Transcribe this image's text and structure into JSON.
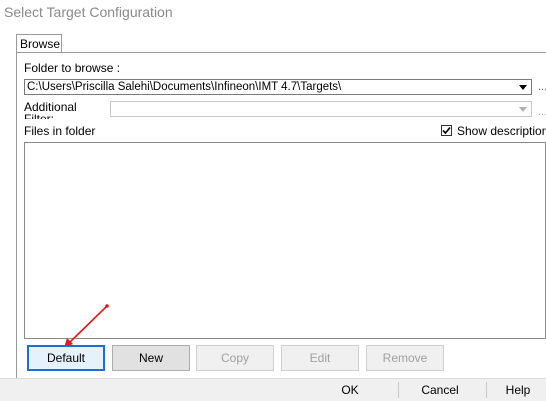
{
  "window": {
    "title": "Select Target Configuration"
  },
  "tabs": [
    {
      "label": "Browse"
    }
  ],
  "folder": {
    "label": "Folder to browse :",
    "value": "C:\\Users\\Priscilla Salehi\\Documents\\Infineon\\IMT 4.7\\Targets\\",
    "ellipsis": "..."
  },
  "filter": {
    "label_line1": "Additional",
    "label_line2": "Filter:",
    "value": "",
    "ellipsis": "..."
  },
  "files": {
    "label": "Files in folder",
    "show_descriptions_label": "Show descriptions",
    "show_descriptions_checked": true,
    "items": []
  },
  "buttons": {
    "default": "Default",
    "new": "New",
    "copy": "Copy",
    "edit": "Edit",
    "remove": "Remove"
  },
  "dialog_buttons": {
    "ok": "OK",
    "cancel": "Cancel",
    "help": "Help"
  },
  "annotation": {
    "arrow_color": "#e01b1b"
  },
  "colors": {
    "default_button_border": "#1b6fcf"
  }
}
